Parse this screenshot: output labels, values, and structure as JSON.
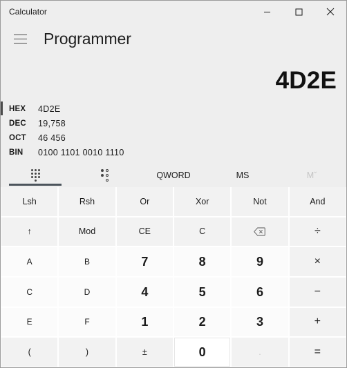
{
  "window": {
    "title": "Calculator",
    "controls": [
      {
        "name": "minimize",
        "label": "—"
      },
      {
        "name": "maximize",
        "label": "□"
      },
      {
        "name": "close",
        "label": "✕"
      }
    ]
  },
  "header": {
    "menu_icon": "hamburger-icon",
    "mode_title": "Programmer"
  },
  "display": {
    "value": "4D2E"
  },
  "bases": [
    {
      "label": "HEX",
      "value": "4D2E",
      "selected": true
    },
    {
      "label": "DEC",
      "value": "19,758",
      "selected": false
    },
    {
      "label": "OCT",
      "value": "46 456",
      "selected": false
    },
    {
      "label": "BIN",
      "value": "0100 1101 0010 1110",
      "selected": false
    }
  ],
  "toolbar": [
    {
      "name": "keypad-tab",
      "label": "",
      "icon": "keypad-icon",
      "selected": true,
      "disabled": false
    },
    {
      "name": "bit-toggle-tab",
      "label": "",
      "icon": "bit-toggle-icon",
      "selected": false,
      "disabled": false
    },
    {
      "name": "word-size-qword",
      "label": "QWORD",
      "icon": "",
      "selected": false,
      "disabled": false
    },
    {
      "name": "memory-store",
      "label": "MS",
      "icon": "",
      "selected": false,
      "disabled": false
    },
    {
      "name": "memory-dropdown",
      "label": "Mˇ",
      "icon": "",
      "selected": false,
      "disabled": true
    }
  ],
  "keys": [
    {
      "name": "lsh-button",
      "label": "Lsh",
      "kind": "fn"
    },
    {
      "name": "rsh-button",
      "label": "Rsh",
      "kind": "fn"
    },
    {
      "name": "or-button",
      "label": "Or",
      "kind": "fn"
    },
    {
      "name": "xor-button",
      "label": "Xor",
      "kind": "fn"
    },
    {
      "name": "not-button",
      "label": "Not",
      "kind": "fn"
    },
    {
      "name": "and-button",
      "label": "And",
      "kind": "fn"
    },
    {
      "name": "shift-up-button",
      "label": "↑",
      "kind": "fn"
    },
    {
      "name": "mod-button",
      "label": "Mod",
      "kind": "fn"
    },
    {
      "name": "clear-entry-button",
      "label": "CE",
      "kind": "fn"
    },
    {
      "name": "clear-button",
      "label": "C",
      "kind": "fn"
    },
    {
      "name": "backspace-button",
      "label": "",
      "kind": "fn",
      "icon": "backspace-icon"
    },
    {
      "name": "divide-button",
      "label": "÷",
      "kind": "op"
    },
    {
      "name": "hex-a-button",
      "label": "A",
      "kind": "hex"
    },
    {
      "name": "hex-b-button",
      "label": "B",
      "kind": "hex"
    },
    {
      "name": "digit-7-button",
      "label": "7",
      "kind": "num"
    },
    {
      "name": "digit-8-button",
      "label": "8",
      "kind": "num"
    },
    {
      "name": "digit-9-button",
      "label": "9",
      "kind": "num"
    },
    {
      "name": "multiply-button",
      "label": "×",
      "kind": "op"
    },
    {
      "name": "hex-c-button",
      "label": "C",
      "kind": "hex"
    },
    {
      "name": "hex-d-button",
      "label": "D",
      "kind": "hex"
    },
    {
      "name": "digit-4-button",
      "label": "4",
      "kind": "num"
    },
    {
      "name": "digit-5-button",
      "label": "5",
      "kind": "num"
    },
    {
      "name": "digit-6-button",
      "label": "6",
      "kind": "num"
    },
    {
      "name": "subtract-button",
      "label": "−",
      "kind": "op"
    },
    {
      "name": "hex-e-button",
      "label": "E",
      "kind": "hex"
    },
    {
      "name": "hex-f-button",
      "label": "F",
      "kind": "hex"
    },
    {
      "name": "digit-1-button",
      "label": "1",
      "kind": "num"
    },
    {
      "name": "digit-2-button",
      "label": "2",
      "kind": "num"
    },
    {
      "name": "digit-3-button",
      "label": "3",
      "kind": "num"
    },
    {
      "name": "add-button",
      "label": "+",
      "kind": "op"
    },
    {
      "name": "left-paren-button",
      "label": "(",
      "kind": "fn"
    },
    {
      "name": "right-paren-button",
      "label": ")",
      "kind": "fn"
    },
    {
      "name": "plus-minus-button",
      "label": "±",
      "kind": "fn"
    },
    {
      "name": "digit-0-button",
      "label": "0",
      "kind": "num",
      "state": "hover"
    },
    {
      "name": "decimal-point-button",
      "label": ".",
      "kind": "fn",
      "state": "disabled"
    },
    {
      "name": "equals-button",
      "label": "=",
      "kind": "op"
    }
  ],
  "colors": {
    "window_bg": "#eeeeee",
    "key_bg": "#f2f2f2",
    "num_key_bg": "#fbfbfb",
    "accent_underline": "#4c545c",
    "text": "#1b1b1b"
  }
}
